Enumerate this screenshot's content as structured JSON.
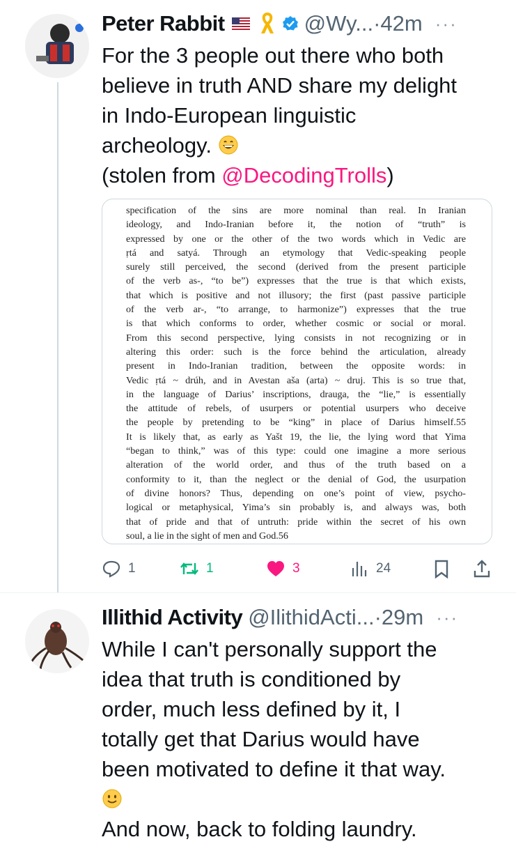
{
  "tweet1": {
    "author": "Peter Rabbit",
    "handle": "@Wy...",
    "time": "·42m",
    "more": "···",
    "text_lines": [
      "For the 3 people out there who both",
      "believe in truth AND share my delight",
      "in Indo-European linguistic",
      "archeology."
    ],
    "stolen_prefix": "(stolen from ",
    "mention": "@DecodingTrolls",
    "stolen_suffix": ")",
    "image_text": [
      "specification of the sins are more nominal than real. In Iranian",
      "ideology, and Indo-Iranian before it, the notion of “truth” is",
      "expressed by one or the other of the two words which in Vedic are",
      "ṛtá and satyá. Through an etymology that Vedic-speaking people",
      "surely still perceived, the second (derived from the present participle",
      "of the verb as-, “to be”) expresses that the true is that which exists,",
      "that which is positive and not illusory; the first (past passive participle",
      "of the verb ar-, “to arrange, to harmonize”) expresses that the true",
      "is that which conforms to order, whether cosmic or social or moral.",
      "From this second perspective, lying consists in not recognizing or in",
      "altering this order: such is the force behind the articulation, already",
      "present in Indo-Iranian tradition, between the opposite words: in",
      "Vedic ṛtá ~ drúh, and in Avestan aša (arta) ~ druj. This is so true that,",
      "in the language of Darius’ inscriptions, drauga, the “lie,” is essentially",
      "the attitude of rebels, of usurpers or potential usurpers who deceive",
      "the people by pretending to be “king” in place of Darius himself.55",
      "It is likely that, as early as Yašt 19, the lie, the lying word that Yima",
      "“began to think,” was of this type: could one imagine a more serious",
      "alteration of the world order, and thus of the truth based on a",
      "conformity to it, than the neglect or the denial of God, the usurpation",
      "of divine honors? Thus, depending on one’s point of view, psycho-",
      "logical or metaphysical, Yima’s sin probably is, and always was, both",
      "that of pride and that of untruth: pride within the secret of his own",
      "soul, a lie in the sight of men and God.56"
    ],
    "actions": {
      "replies": "1",
      "reposts": "1",
      "likes": "3",
      "views": "24"
    }
  },
  "tweet2": {
    "author": "Illithid Activity",
    "handle": "@IlithidActi...",
    "time": "·29m",
    "more": "···",
    "text_lines": [
      "While I can't personally support the",
      "idea that truth is conditioned by",
      "order, much less defined by it, I",
      "totally get that Darius would have",
      "been motivated to define it that way."
    ],
    "closing": "And now, back to folding laundry."
  },
  "colors": {
    "accent_pink": "#f91880",
    "repost_green": "#00ba7c",
    "verified_blue": "#1d9bf0",
    "secondary_text": "#536471"
  },
  "icons": [
    "reply-icon",
    "repost-icon",
    "heart-icon",
    "views-icon",
    "bookmark-icon",
    "share-icon",
    "verified-icon",
    "flag-icon",
    "ribbon-icon"
  ]
}
